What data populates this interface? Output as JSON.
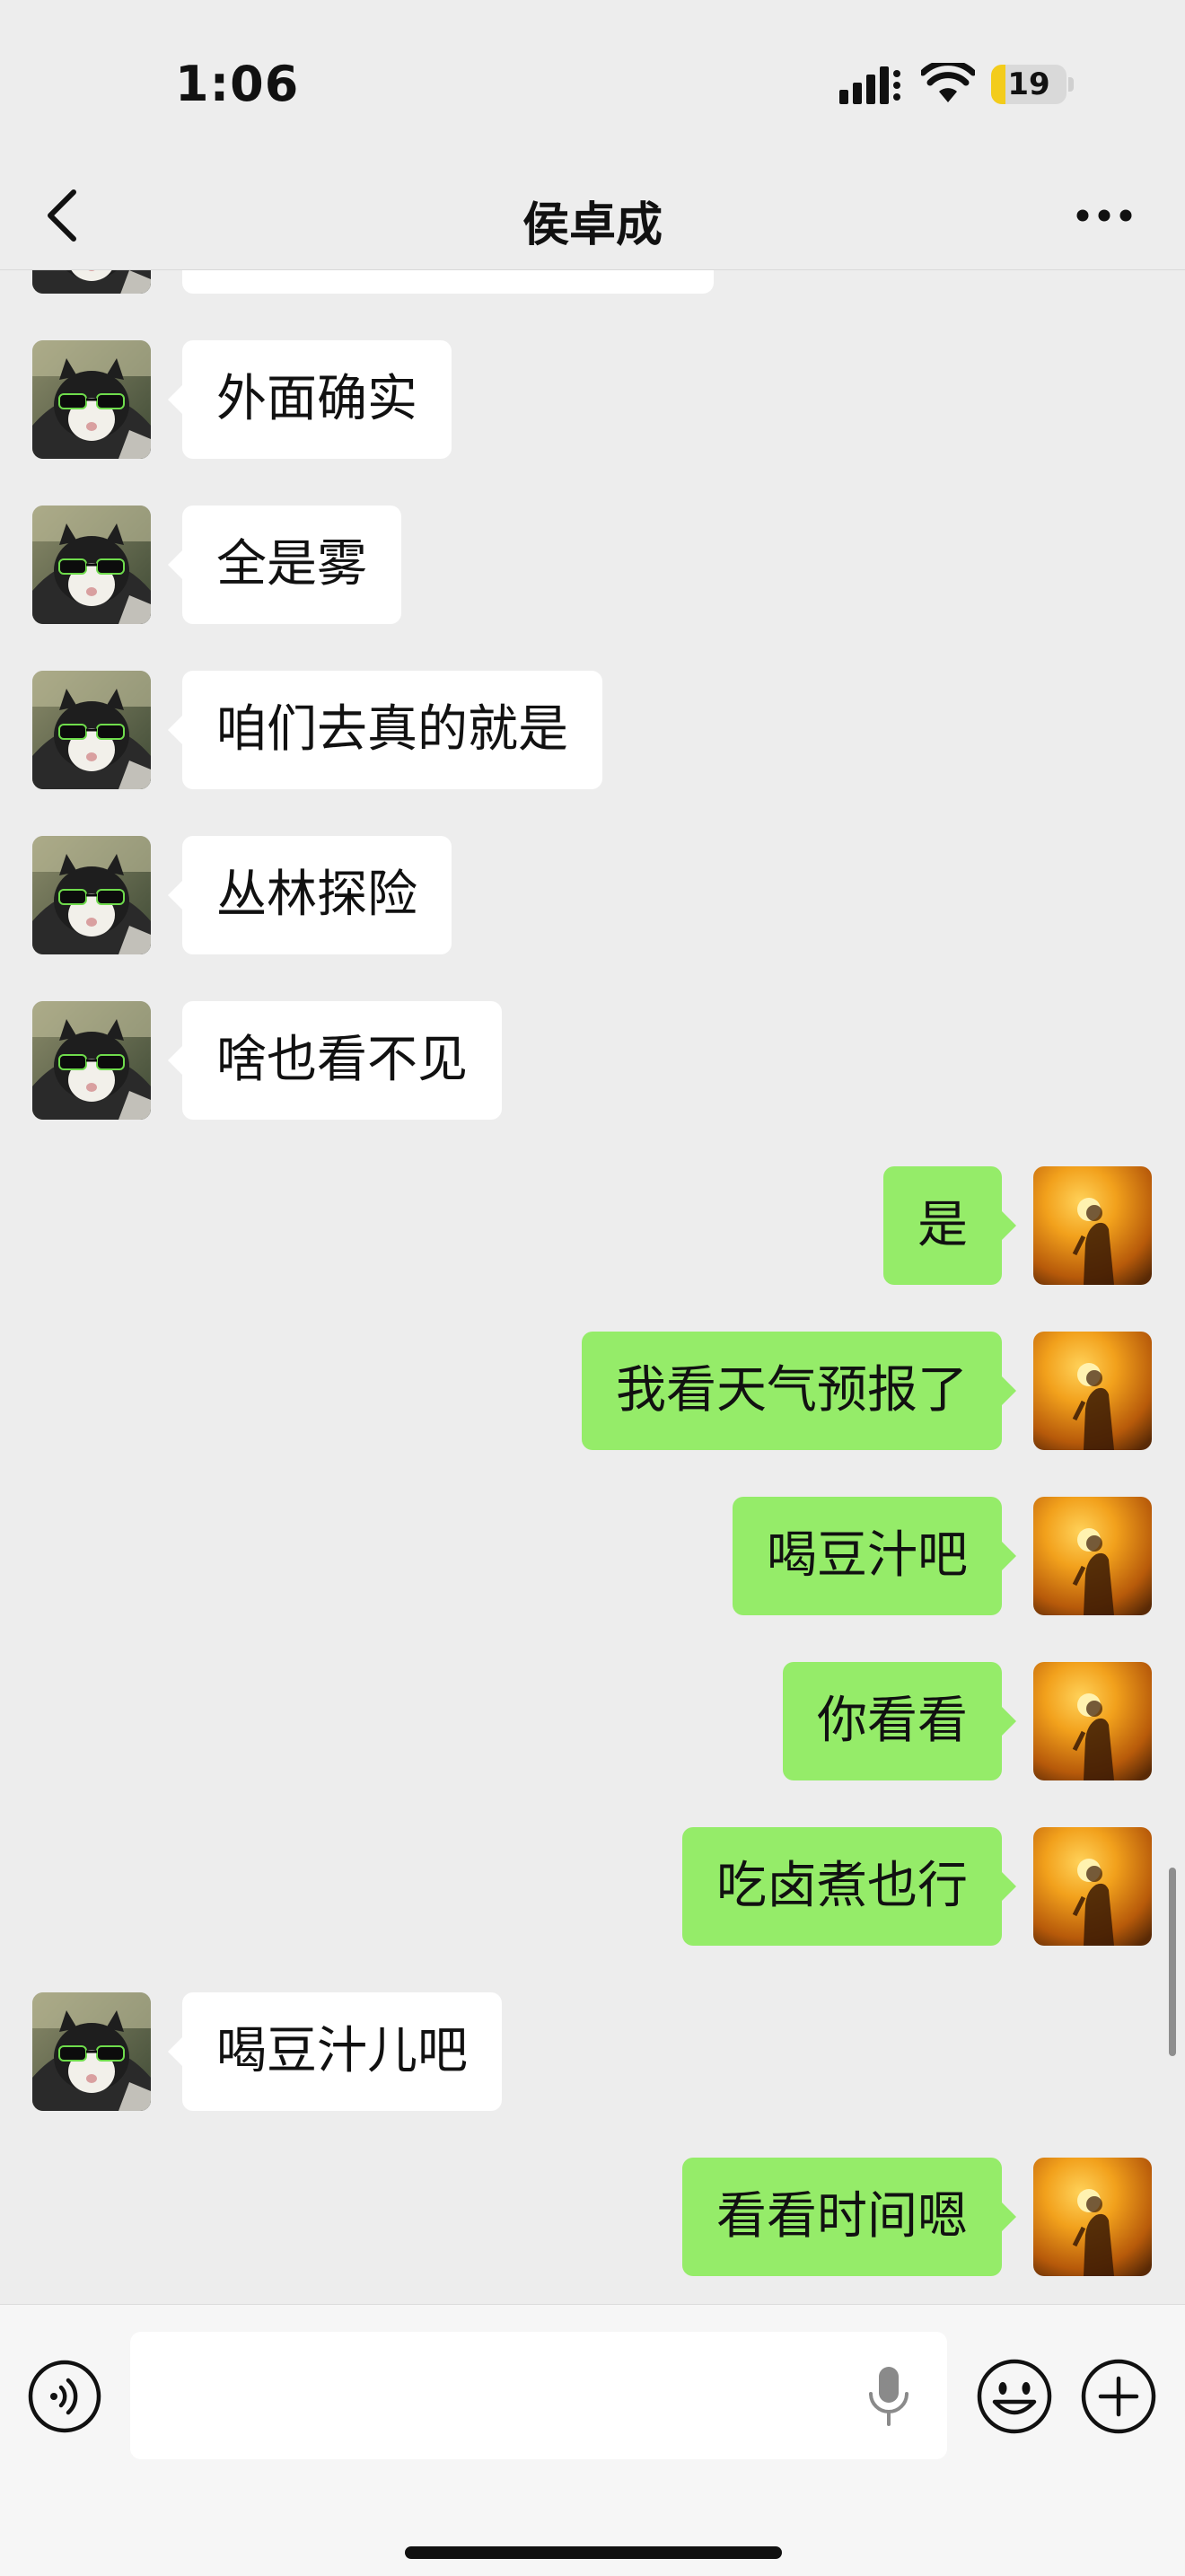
{
  "status_bar": {
    "time": "1:06",
    "battery": "19",
    "battery_level": 0.19,
    "icons": [
      "cellular-signal-icon",
      "wifi-icon",
      "battery-icon"
    ]
  },
  "nav": {
    "title": "侯卓成",
    "back_icon": "chevron-left-icon",
    "more_icon": "more-dots-icon"
  },
  "messages": [
    {
      "dir": "in",
      "text": "外面确实"
    },
    {
      "dir": "in",
      "text": "全是雾"
    },
    {
      "dir": "in",
      "text": "咱们去真的就是"
    },
    {
      "dir": "in",
      "text": "丛林探险"
    },
    {
      "dir": "in",
      "text": "啥也看不见"
    },
    {
      "dir": "out",
      "text": "是"
    },
    {
      "dir": "out",
      "text": "我看天气预报了"
    },
    {
      "dir": "out",
      "text": "喝豆汁吧"
    },
    {
      "dir": "out",
      "text": "你看看"
    },
    {
      "dir": "out",
      "text": "吃卤煮也行"
    },
    {
      "dir": "in",
      "text": "喝豆汁儿吧"
    },
    {
      "dir": "out",
      "text": "看看时间嗯"
    }
  ],
  "input_bar": {
    "placeholder": "",
    "icons": [
      "voice-icon",
      "microphone-icon",
      "emoji-icon",
      "plus-icon"
    ]
  },
  "colors": {
    "background": "#ededed",
    "outgoing_bubble": "#95ec69",
    "incoming_bubble": "#ffffff",
    "battery_fill": "#f3cc1b"
  }
}
